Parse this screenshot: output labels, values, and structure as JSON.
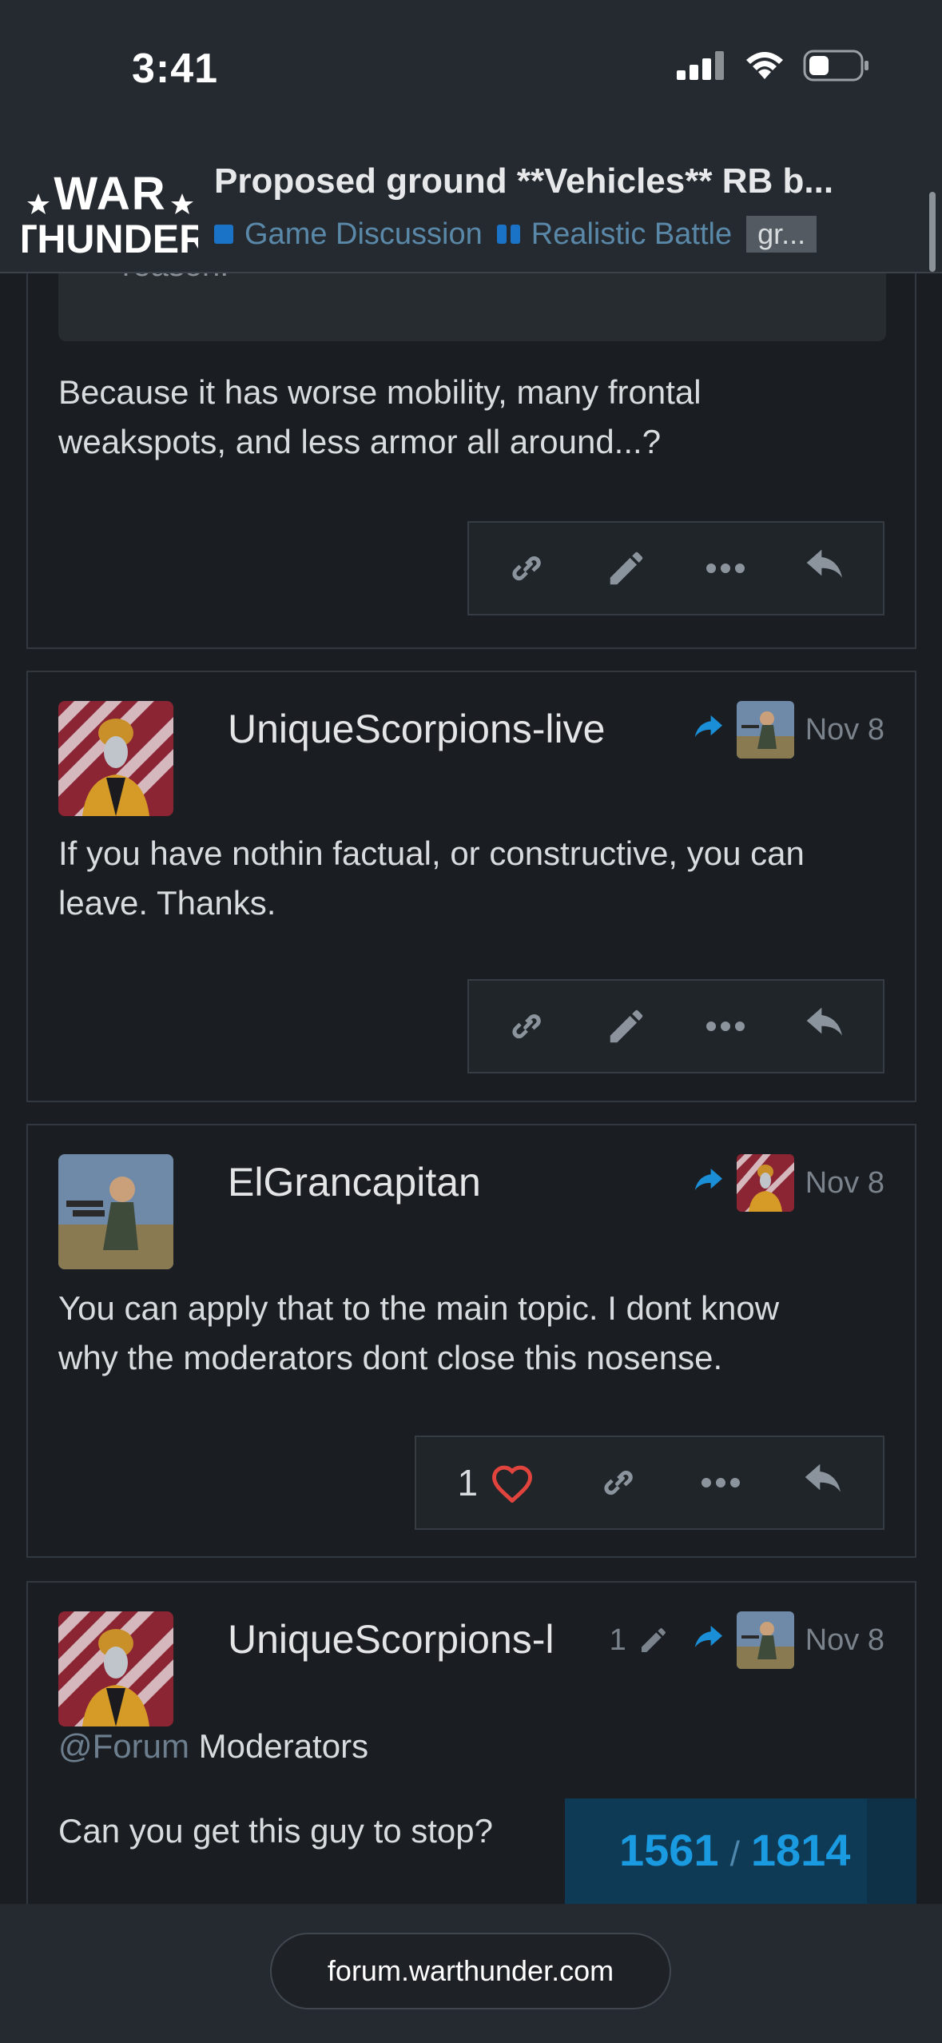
{
  "status_bar": {
    "time": "3:41"
  },
  "header": {
    "logo_text": "WAR THUNDER",
    "topic_title": "Proposed ground **Vehicles** RB b...",
    "breadcrumbs": [
      {
        "label": "Game Discussion",
        "color": "#1a73c7"
      },
      {
        "label": "Realistic Battle",
        "color": "#1a73c7"
      }
    ],
    "tag": "gr..."
  },
  "posts": [
    {
      "quote_tail": "reason.",
      "body": [
        "Because it has worse mobility, many frontal",
        "weakspots, and less armor all around...?"
      ],
      "actions": [
        "link-icon",
        "edit-icon",
        "more-icon",
        "reply-icon"
      ]
    },
    {
      "username": "UniqueScorpions-live",
      "date": "Nov 8",
      "body": [
        "If you have nothin factual, or constructive, you can",
        "leave. Thanks."
      ],
      "actions": [
        "link-icon",
        "edit-icon",
        "more-icon",
        "reply-icon"
      ]
    },
    {
      "username": "ElGrancapitan",
      "date": "Nov 8",
      "likes": "1",
      "body": [
        "You can apply that to the main topic. I dont know",
        "why the moderators dont close this nosense."
      ],
      "actions": [
        "like-icon",
        "link-icon",
        "more-icon",
        "reply-icon"
      ]
    },
    {
      "username": "UniqueScorpions-l",
      "edit_count": "1",
      "date": "Nov 8",
      "mention": "@Forum",
      "body_line1_rest": " Moderators",
      "body_line2": "Can you get this guy to stop?"
    }
  ],
  "progress": {
    "current": "1561",
    "separator": "/",
    "total": "1814"
  },
  "browser": {
    "url": "forum.warthunder.com"
  },
  "colors": {
    "accent": "#1a9ae0",
    "heart": "#e0443c",
    "background": "#1a1d21"
  }
}
